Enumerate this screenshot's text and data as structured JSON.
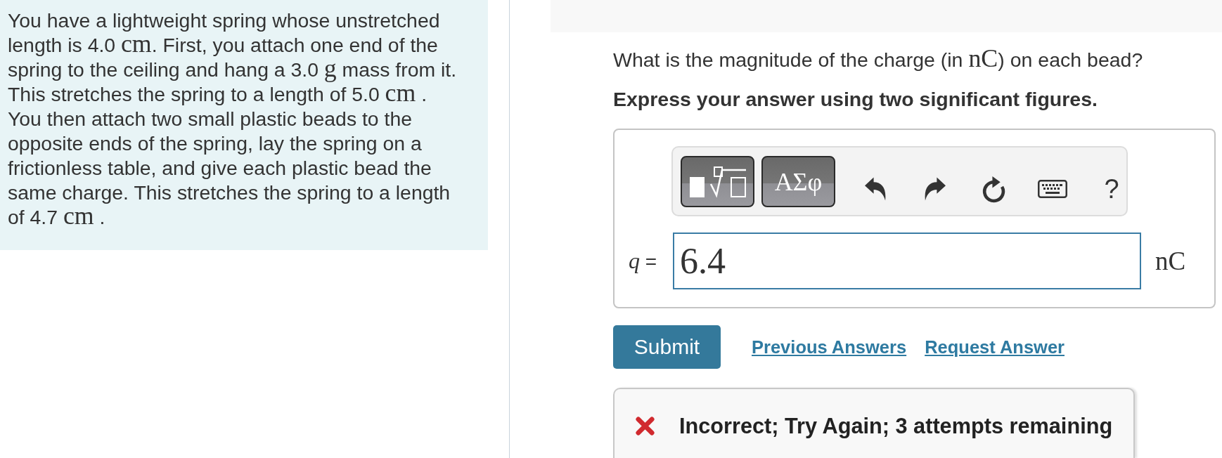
{
  "problem": {
    "parts": [
      {
        "kind": "text",
        "text": "You have a lightweight spring whose unstretched length is 4.0 "
      },
      {
        "kind": "math",
        "text": "cm"
      },
      {
        "kind": "text",
        "text": ". First, you attach one end of the spring to the ceiling and hang a 3.0 "
      },
      {
        "kind": "math",
        "text": "g"
      },
      {
        "kind": "text",
        "text": " mass from it. This stretches the spring to a length of 5.0 "
      },
      {
        "kind": "math",
        "text": "cm"
      },
      {
        "kind": "text",
        "text": " . You then attach two small plastic beads to the opposite ends of the spring, lay the spring on a frictionless table, and give each plastic bead the same charge. This stretches the spring to a length of 4.7 "
      },
      {
        "kind": "math",
        "text": "cm"
      },
      {
        "kind": "text",
        "text": " ."
      }
    ]
  },
  "question": {
    "parts": [
      {
        "kind": "text",
        "text": "What is the magnitude of the charge (in "
      },
      {
        "kind": "math",
        "text": "nC"
      },
      {
        "kind": "text",
        "text": ") on each bead?"
      }
    ]
  },
  "instruction": "Express your answer using two significant figures.",
  "toolbar": {
    "buttons": [
      {
        "kind": "templates"
      },
      {
        "kind": "symbols",
        "label": "ΑΣφ"
      },
      {
        "kind": "undo"
      },
      {
        "kind": "redo"
      },
      {
        "kind": "reset"
      },
      {
        "kind": "keyboard"
      },
      {
        "kind": "help",
        "label": "?"
      }
    ]
  },
  "answer": {
    "variable": "q",
    "equals": "=",
    "value": "6.4",
    "unit": "nC"
  },
  "actions": {
    "submit": "Submit",
    "links": [
      "Previous Answers",
      "Request Answer"
    ]
  },
  "feedback": {
    "correct": false,
    "message": "Incorrect; Try Again; 3 attempts remaining"
  }
}
